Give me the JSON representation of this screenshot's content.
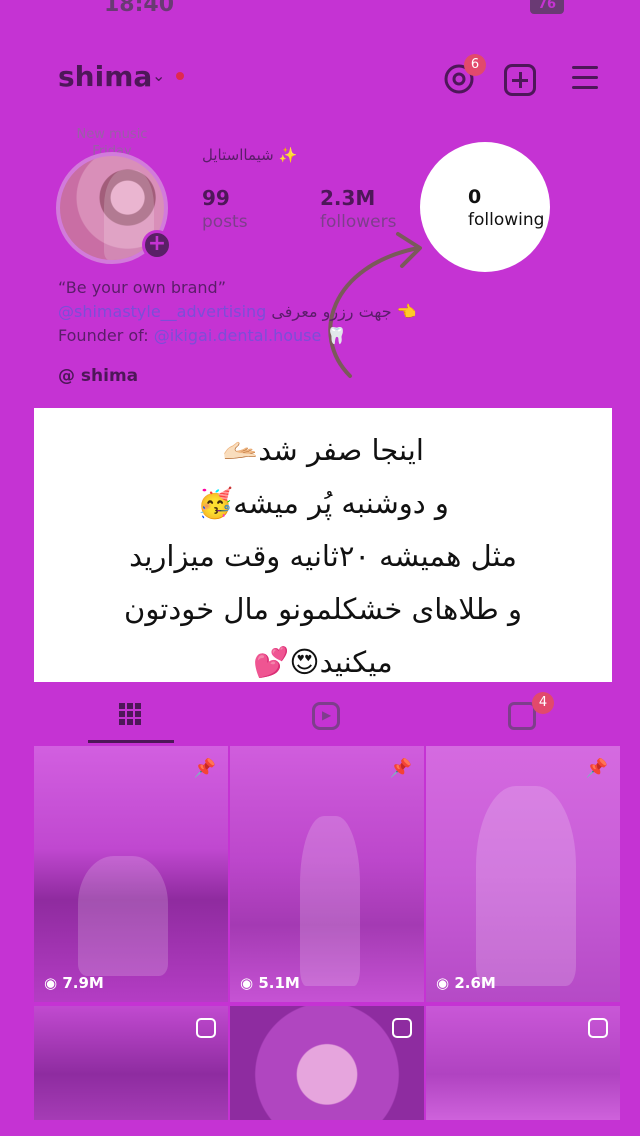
{
  "status_bar": {
    "time": "18:40",
    "battery": "76"
  },
  "header": {
    "username": "shima",
    "threads_badge": "6"
  },
  "profile": {
    "note_line1": "New music",
    "note_line2": "Friday",
    "display_name": "شیمااستایل ✨",
    "posts_count": "99",
    "posts_label": "posts",
    "followers_count": "2.3M",
    "followers_label": "followers",
    "following_count": "0",
    "following_label": "following",
    "bio_line1": "“Be your own brand”",
    "bio_line2_link": "@shimastyle__advertising",
    "bio_line2_text": " جهت رزرو معرفی 👈",
    "bio_line3_text": "Founder of: ",
    "bio_line3_link": "@ikigai.dental.house",
    "bio_line3_emoji": " 🦷",
    "threads_handle": "shima"
  },
  "overlay": {
    "line1": "اینجا صفر شد🫴🏻",
    "line2": "و دوشنبه پُر میشه🥳",
    "line3": "مثل همیشه ۲۰ثانیه وقت میزارید",
    "line4": "و طلاهای خشکلمونو مال خودتون",
    "line5": "میکنید😍💕"
  },
  "tabs": {
    "tagged_badge": "4"
  },
  "grid": [
    {
      "views": "7.9M",
      "pinned": true
    },
    {
      "views": "5.1M",
      "pinned": true
    },
    {
      "views": "2.6M",
      "pinned": true
    },
    {
      "views": "",
      "reel": true
    },
    {
      "views": "",
      "reel": true
    },
    {
      "views": "",
      "reel": true
    }
  ]
}
